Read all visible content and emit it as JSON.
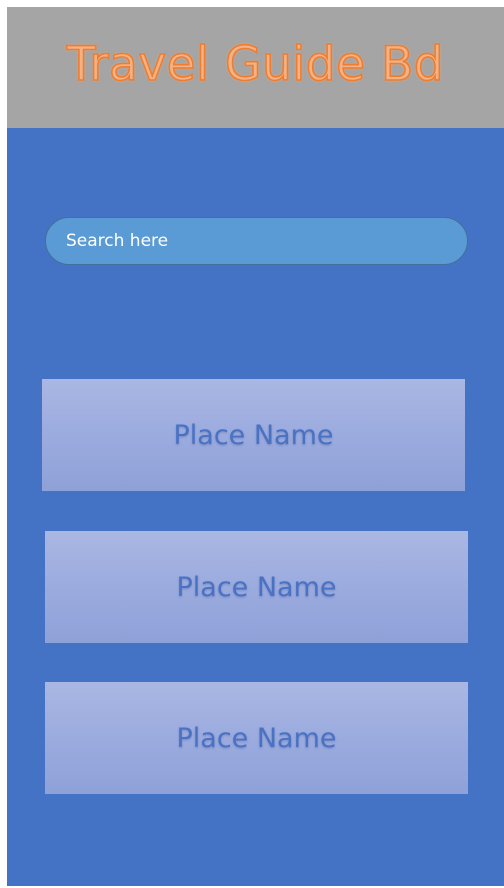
{
  "header": {
    "title": "Travel Guide Bd"
  },
  "search": {
    "placeholder": "Search here",
    "value": ""
  },
  "places": [
    {
      "label": "Place Name"
    },
    {
      "label": "Place Name"
    },
    {
      "label": "Place Name"
    }
  ],
  "colors": {
    "background": "#4472c4",
    "header": "#a5a5a5",
    "title_fill": "#f4b183",
    "title_outline": "#ed7d31",
    "search_fill": "#5b9bd5",
    "card_fill": "#9aaade",
    "card_text": "#4a72c4"
  }
}
